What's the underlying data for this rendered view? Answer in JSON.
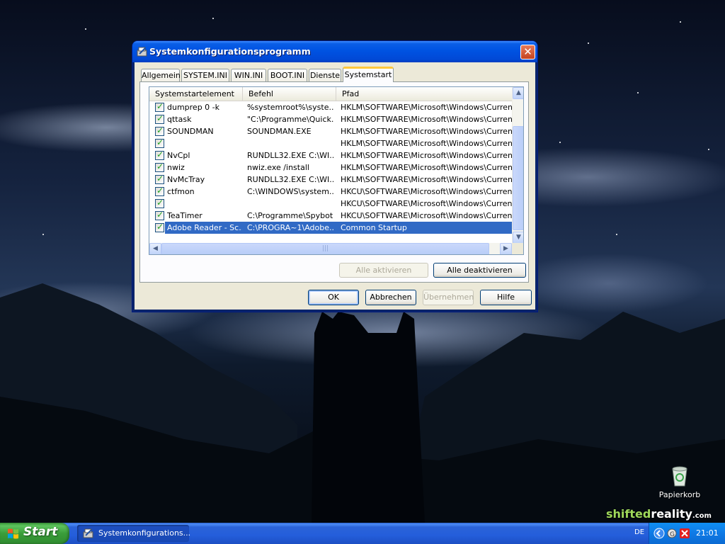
{
  "window": {
    "title": "Systemkonfigurationsprogramm",
    "close_symbol": "✕",
    "tabs": [
      {
        "label": "Allgemein"
      },
      {
        "label": "SYSTEM.INI"
      },
      {
        "label": "WIN.INI"
      },
      {
        "label": "BOOT.INI"
      },
      {
        "label": "Dienste"
      },
      {
        "label": "Systemstart"
      }
    ],
    "active_tab": "Systemstart",
    "list": {
      "columns": [
        "Systemstartelement",
        "Befehl",
        "Pfad"
      ],
      "rows": [
        {
          "checked": true,
          "name": "dumprep 0 -k",
          "command": "%systemroot%\\syste...",
          "path": "HKLM\\SOFTWARE\\Microsoft\\Windows\\CurrentVer..."
        },
        {
          "checked": true,
          "name": "qttask",
          "command": "\"C:\\Programme\\Quick...",
          "path": "HKLM\\SOFTWARE\\Microsoft\\Windows\\CurrentVer..."
        },
        {
          "checked": true,
          "name": "SOUNDMAN",
          "command": "SOUNDMAN.EXE",
          "path": "HKLM\\SOFTWARE\\Microsoft\\Windows\\CurrentVer..."
        },
        {
          "checked": true,
          "name": "",
          "command": "",
          "path": "HKLM\\SOFTWARE\\Microsoft\\Windows\\CurrentVer..."
        },
        {
          "checked": true,
          "name": "NvCpl",
          "command": "RUNDLL32.EXE C:\\WI...",
          "path": "HKLM\\SOFTWARE\\Microsoft\\Windows\\CurrentVer..."
        },
        {
          "checked": true,
          "name": "nwiz",
          "command": "nwiz.exe /install",
          "path": "HKLM\\SOFTWARE\\Microsoft\\Windows\\CurrentVer..."
        },
        {
          "checked": true,
          "name": "NvMcTray",
          "command": "RUNDLL32.EXE C:\\WI...",
          "path": "HKLM\\SOFTWARE\\Microsoft\\Windows\\CurrentVer..."
        },
        {
          "checked": true,
          "name": "ctfmon",
          "command": "C:\\WINDOWS\\system...",
          "path": "HKCU\\SOFTWARE\\Microsoft\\Windows\\CurrentVer..."
        },
        {
          "checked": true,
          "name": "",
          "command": "",
          "path": "HKCU\\SOFTWARE\\Microsoft\\Windows\\CurrentVer..."
        },
        {
          "checked": true,
          "name": "TeaTimer",
          "command": "C:\\Programme\\Spybot...",
          "path": "HKCU\\SOFTWARE\\Microsoft\\Windows\\CurrentVer..."
        },
        {
          "checked": true,
          "name": "Adobe Reader - Sc...",
          "command": "C:\\PROGRA~1\\Adobe...",
          "path": "Common Startup",
          "selected": true
        }
      ]
    },
    "buttons": {
      "enable_all": "Alle aktivieren",
      "disable_all": "Alle deaktivieren",
      "ok": "OK",
      "cancel": "Abbrechen",
      "apply": "Übernehmen",
      "help": "Hilfe"
    }
  },
  "desktop": {
    "recycle_bin_label": "Papierkorb",
    "watermark": {
      "part1": "shifted",
      "part2": "reality",
      "part3": ".com"
    }
  },
  "taskbar": {
    "start_label": "Start",
    "task_item": "Systemkonfigurations...",
    "language": "DE",
    "clock": "21:01"
  },
  "colors": {
    "selection": "#316ac5",
    "titlebar": "#0054e3",
    "taskbar": "#245edb",
    "start_green": "#3a9d3a"
  }
}
